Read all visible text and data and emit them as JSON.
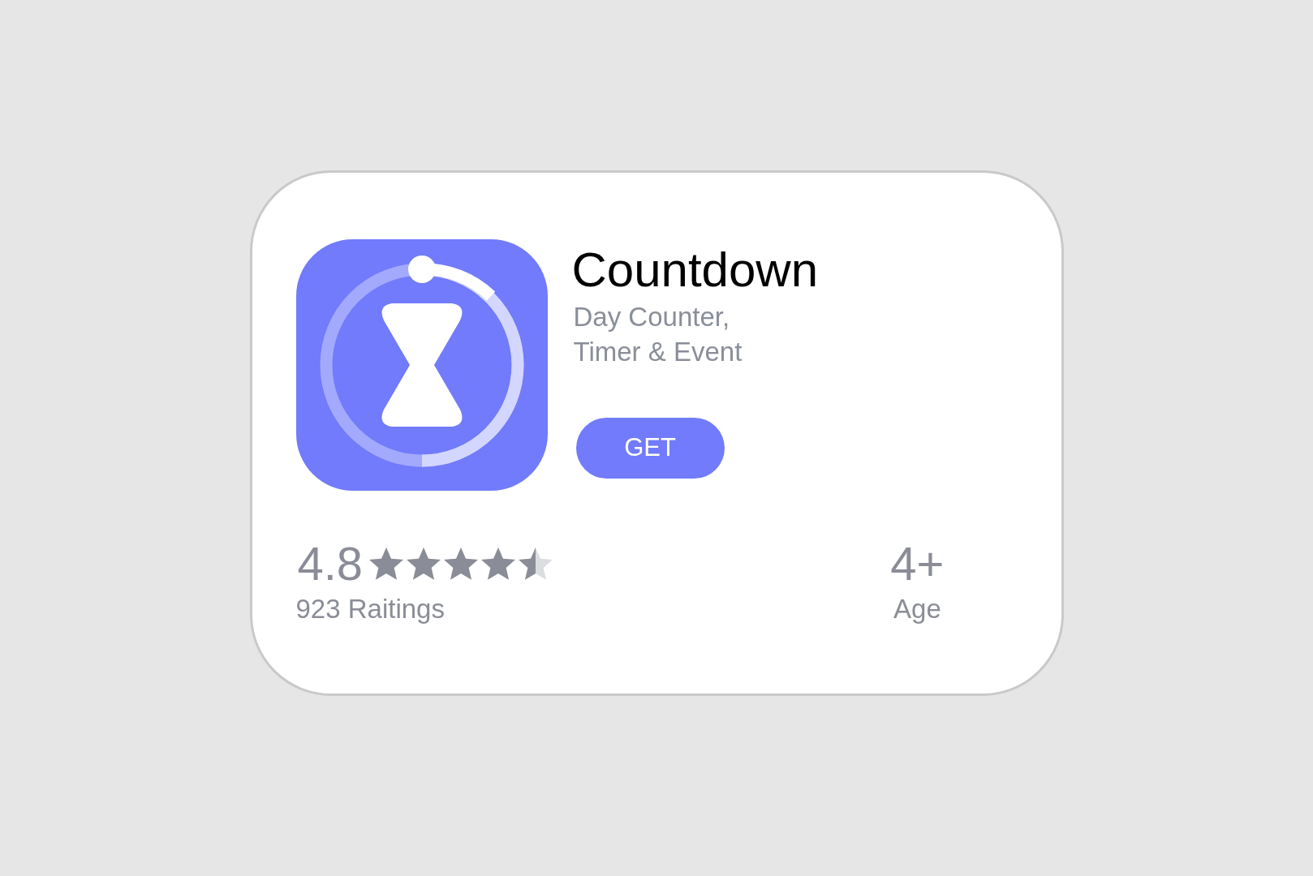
{
  "app": {
    "name": "Countdown",
    "subtitle_lines": [
      "Day Counter,",
      "Timer & Event"
    ],
    "button": "GET"
  },
  "rating": {
    "score": "4.8",
    "stars": 4.5,
    "count": "923 Raitings"
  },
  "age": {
    "value": "4+",
    "label": "Age"
  }
}
